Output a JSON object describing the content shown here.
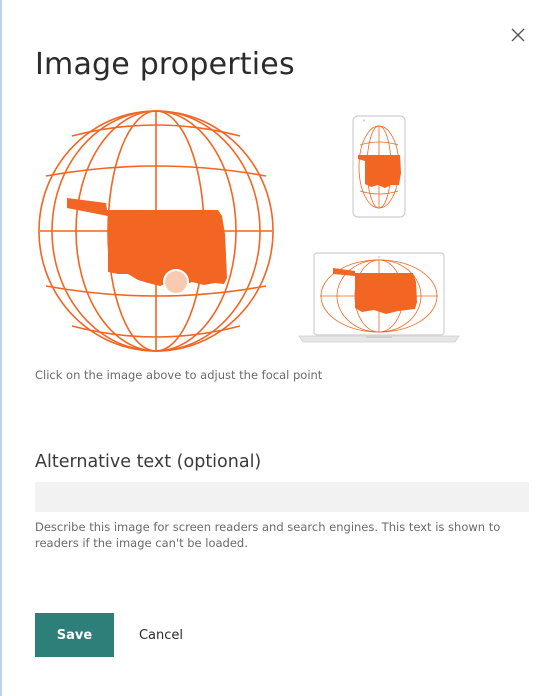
{
  "dialog": {
    "title": "Image properties",
    "close_icon": "close-icon"
  },
  "focal_point": {
    "hint": "Click on the image above to adjust the focal point"
  },
  "alt_text": {
    "label": "Alternative text (optional)",
    "value": "",
    "placeholder": "",
    "help": "Describe this image for screen readers and search engines. This text is shown to readers if the image can't be loaded."
  },
  "actions": {
    "save_label": "Save",
    "cancel_label": "Cancel"
  },
  "colors": {
    "accent": "#f26522",
    "primary_button": "#2d7f7a",
    "input_background": "#f2f2f2"
  }
}
